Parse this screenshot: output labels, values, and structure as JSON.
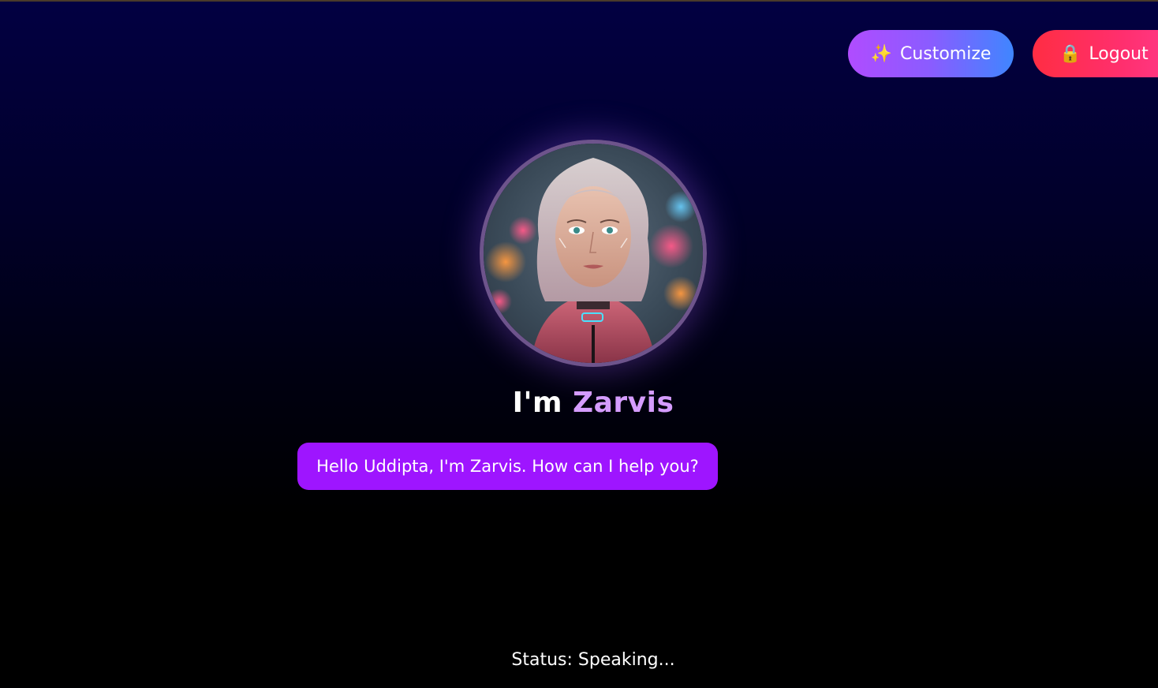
{
  "header": {
    "customize_icon": "✨",
    "customize_label": "Customize",
    "logout_icon": "🔒",
    "logout_label": "Logout"
  },
  "assistant": {
    "avatar_alt": "sparkles-icon",
    "title_prefix": "I'm ",
    "name": "Zarvis",
    "greeting": "Hello Uddipta, I'm Zarvis. How can I help you?"
  },
  "status": {
    "text": "Status: Speaking..."
  },
  "colors": {
    "customize_gradient_start": "#b04cff",
    "customize_gradient_end": "#3f86ff",
    "logout_gradient_start": "#ff2d43",
    "logout_gradient_end": "#ff3a8a",
    "bubble": "#9e15ff",
    "name_accent": "#d59cff",
    "background_top": "#020042",
    "background_bottom": "#000000"
  }
}
